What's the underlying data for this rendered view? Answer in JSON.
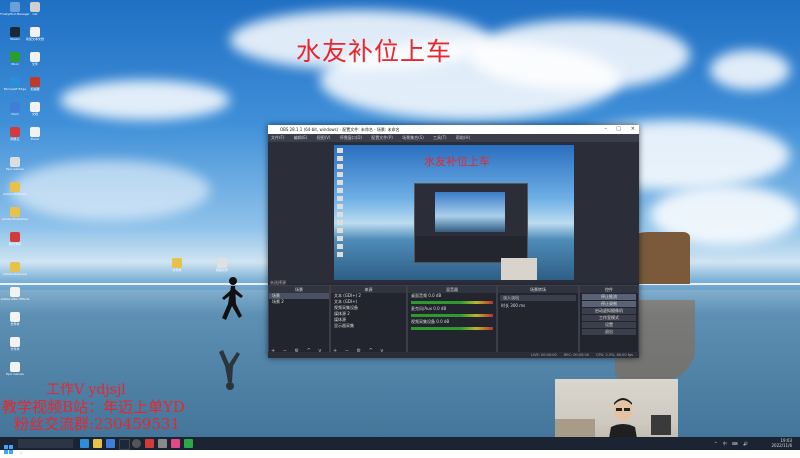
{
  "overlay": {
    "title": "水友补位上车",
    "line1": "工作V ydjsjl",
    "line2": "教学视频B站：年迈上单YD",
    "line3": "粉丝交流群:230459531",
    "text_color": "#e8262d"
  },
  "desktop_icons": [
    {
      "label": "FrostyMod Manager",
      "color": "#6aa0d8"
    },
    {
      "label": "Cat",
      "color": "#d0d0d0"
    },
    {
      "label": "Steam",
      "color": "#1b2838"
    },
    {
      "label": "新建文本文档",
      "color": "#f2f2f2"
    },
    {
      "label": "OBS Studio",
      "color": "#303030"
    },
    {
      "label": "文件",
      "color": "#f2f2f2"
    },
    {
      "label": "Xbox",
      "color": "#2a9d2a"
    },
    {
      "label": "加速器",
      "color": "#c0392b"
    },
    {
      "label": "Microsoft Edge",
      "color": "#2b8fd8"
    },
    {
      "label": "文档",
      "color": "#f2f2f2"
    },
    {
      "label": "Docs",
      "color": "#3f7fd8"
    },
    {
      "label": "Excel",
      "color": "#f2f2f2"
    },
    {
      "label": "网易云",
      "color": "#d33a3a"
    },
    {
      "label": "NVIDIA GeForce",
      "color": "#f2f2f2"
    },
    {
      "label": "Epic Games",
      "color": "#dddddd"
    },
    {
      "label": "Adobe Premiere",
      "color": "#e8c14a"
    },
    {
      "label": "Adobe Photoshop",
      "color": "#e8c14a"
    },
    {
      "label": "腾讯游戏",
      "color": "#d33a3a"
    },
    {
      "label": "Adobe Premiere",
      "color": "#e8c14a"
    },
    {
      "label": "Adobe After Effects",
      "color": "#f2f2f2"
    },
    {
      "label": "文件夹",
      "color": "#f2f2f2"
    },
    {
      "label": "文件夹",
      "color": "#f2f2f2"
    },
    {
      "label": "Epic Games",
      "color": "#f2f2f2"
    },
    {
      "label": "Epic Games",
      "color": "#f2f2f2"
    },
    {
      "label": "文件",
      "color": "#f2f2f2"
    }
  ],
  "desktop_files": [
    {
      "label": "文件夹",
      "color": "#e8c14a"
    },
    {
      "label": "视频文件",
      "color": "#e0e0e0"
    }
  ],
  "obs": {
    "title": "OBS 28.1.1 (64-bit, windows) - 配置文件: 未命名 - 场景: 未命名",
    "menu": [
      "文件(F)",
      "编辑(E)",
      "视图(V)",
      "停靠窗口(D)",
      "配置文件(P)",
      "场景集合(S)",
      "工具(T)",
      "帮助(H)"
    ],
    "preview_title": "水友补位上车",
    "scene_bar": "未选择源",
    "scenes": {
      "header": "场景",
      "items": [
        "场景",
        "场景 2"
      ]
    },
    "sources": {
      "header": "来源",
      "items": [
        "文本 (GDI+) 2",
        "文本 (GDI+)",
        "视频采集设备",
        "媒体源 2",
        "媒体源",
        "显示器采集"
      ]
    },
    "mixer": {
      "header": "混音器",
      "channels": [
        {
          "name": "桌面音频",
          "db": "0.0 dB"
        },
        {
          "name": "麦克风/Aux",
          "db": "0.0 dB"
        },
        {
          "name": "视频采集设备",
          "db": "0.0 dB"
        }
      ]
    },
    "transitions": {
      "header": "场景转场",
      "type": "淡入淡出",
      "duration_label": "时长",
      "duration": "300 ms"
    },
    "controls": {
      "header": "控件",
      "buttons": [
        "停止推流",
        "停止录制",
        "启动虚拟摄像机",
        "工作室模式",
        "设置",
        "退出"
      ]
    },
    "status": [
      "LIVE: 00:00:00",
      "REC: 00:00:00",
      "CPU: 2.3%, 60.00 fps"
    ],
    "dock_toolbar": "+ − ⚙ ^ v"
  },
  "taskbar": {
    "time": "19:03",
    "date": "2022/11/6",
    "tray": "^ 中 ⌨ 🔊",
    "apps": [
      {
        "name": "windows-start-icon",
        "color": "#3fa6ff"
      },
      {
        "name": "search-icon",
        "color": "#cccccc"
      },
      {
        "name": "task-view-icon",
        "color": "#cccccc"
      },
      {
        "name": "edge-icon",
        "color": "#2b8fd8"
      },
      {
        "name": "folder-icon",
        "color": "#e8c14a"
      },
      {
        "name": "store-icon",
        "color": "#3f7fd8"
      },
      {
        "name": "steam-icon",
        "color": "#1b2838"
      },
      {
        "name": "obs-icon",
        "color": "#555555"
      },
      {
        "name": "music-icon",
        "color": "#d33a3a"
      },
      {
        "name": "game-icon",
        "color": "#e04a8a"
      },
      {
        "name": "chat-icon",
        "color": "#2aa84a"
      }
    ]
  }
}
